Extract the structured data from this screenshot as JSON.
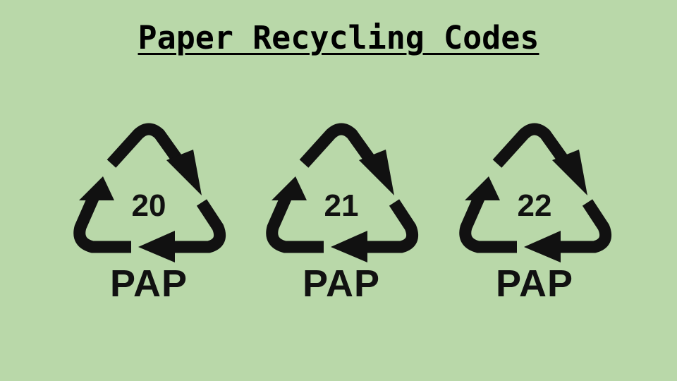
{
  "title": "Paper Recycling Codes",
  "symbols": [
    {
      "number": "20",
      "abbreviation": "PAP",
      "icon": "recycle-triangle-icon"
    },
    {
      "number": "21",
      "abbreviation": "PAP",
      "icon": "recycle-triangle-icon"
    },
    {
      "number": "22",
      "abbreviation": "PAP",
      "icon": "recycle-triangle-icon"
    }
  ],
  "colors": {
    "background": "#b9d8a9",
    "foreground": "#111111"
  }
}
